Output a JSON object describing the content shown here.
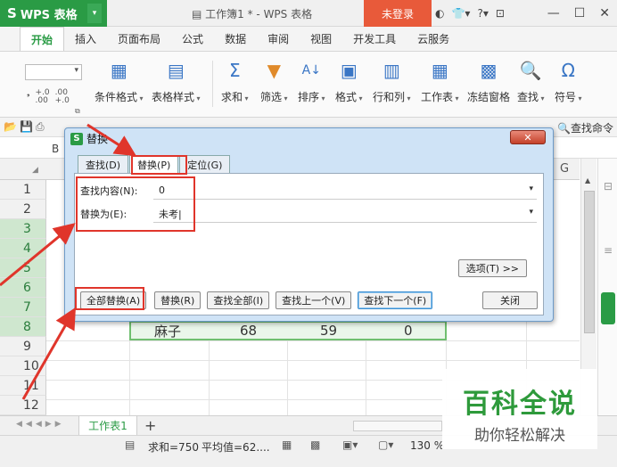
{
  "titlebar": {
    "app_name": "WPS 表格",
    "doc_title": "工作簿1 * - WPS 表格",
    "login": "未登录",
    "icons": [
      "skin-icon",
      "shirt-icon",
      "help-icon",
      "fullscreen-icon"
    ],
    "help": "?"
  },
  "menu": {
    "tabs": [
      "开始",
      "插入",
      "页面布局",
      "公式",
      "数据",
      "审阅",
      "视图",
      "开发工具",
      "云服务"
    ]
  },
  "ribbon": {
    "buttons": [
      {
        "label": "条件格式",
        "icon": "conditional-format-icon"
      },
      {
        "label": "表格样式",
        "icon": "table-style-icon"
      },
      {
        "label": "求和",
        "icon": "sum-icon"
      },
      {
        "label": "筛选",
        "icon": "filter-icon"
      },
      {
        "label": "排序",
        "icon": "sort-icon"
      },
      {
        "label": "格式",
        "icon": "format-icon"
      },
      {
        "label": "行和列",
        "icon": "row-col-icon"
      },
      {
        "label": "工作表",
        "icon": "worksheet-icon"
      },
      {
        "label": "冻结窗格",
        "icon": "freeze-icon"
      },
      {
        "label": "查找",
        "icon": "find-icon"
      },
      {
        "label": "符号",
        "icon": "symbol-icon"
      }
    ],
    "num_format_1": "+.0\n.00",
    "num_format_2": ".00\n+.0"
  },
  "quickbar": {
    "find_cmd": "查找命令"
  },
  "sheet": {
    "cell_ref": "B",
    "col_g": "G",
    "rows": [
      "1",
      "2",
      "3",
      "4",
      "5",
      "6",
      "7",
      "8",
      "9",
      "10",
      "11",
      "12"
    ],
    "data_row": {
      "name": "麻子",
      "v1": "68",
      "v2": "59",
      "v3": "0"
    }
  },
  "sheettabs": {
    "active_tab": "工作表1",
    "add": "+"
  },
  "statusbar": {
    "sum": "求和=750",
    "avg": "平均值=62....",
    "zoom": "130 %"
  },
  "watermark": {
    "title": "百科全说",
    "subtitle": "助你轻松解决"
  },
  "dialog": {
    "title": "替换",
    "tabs": [
      "查找(D)",
      "替换(P)",
      "定位(G)"
    ],
    "active_tab": 1,
    "find_label": "查找内容(N):",
    "find_value": "0",
    "replace_label": "替换为(E):",
    "replace_value": "未考|",
    "options_button": "选项(T) >>",
    "buttons": [
      "全部替换(A)",
      "替换(R)",
      "查找全部(I)",
      "查找上一个(V)",
      "查找下一个(F)"
    ],
    "close_button": "关闭"
  }
}
